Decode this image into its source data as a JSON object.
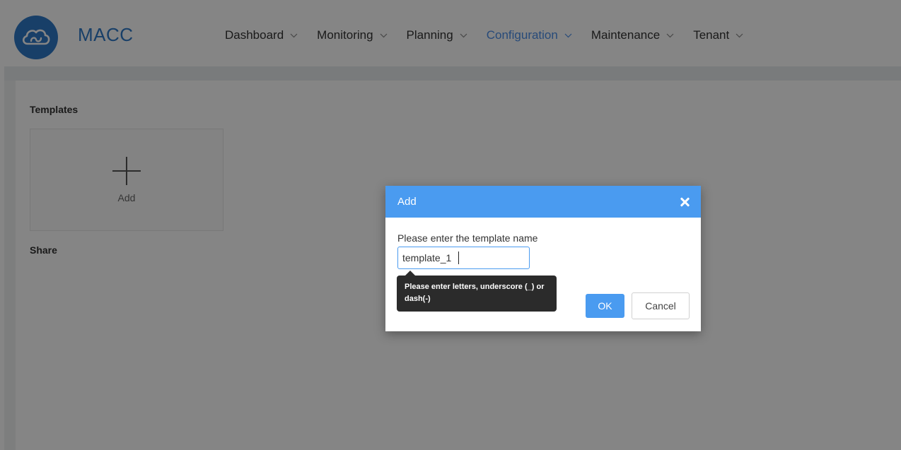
{
  "app": {
    "brand": "MACC",
    "logo_icon": "cloud-logo-icon"
  },
  "nav": {
    "items": [
      {
        "label": "Dashboard",
        "active": false
      },
      {
        "label": "Monitoring",
        "active": false
      },
      {
        "label": "Planning",
        "active": false
      },
      {
        "label": "Configuration",
        "active": true
      },
      {
        "label": "Maintenance",
        "active": false
      },
      {
        "label": "Tenant",
        "active": false
      }
    ]
  },
  "page": {
    "templates_title": "Templates",
    "add_card_label": "Add",
    "share_title": "Share"
  },
  "modal": {
    "title": "Add",
    "prompt": "Please enter the template name",
    "input_value": "template_1",
    "tooltip": "Please enter letters, underscore (_) or dash(-)",
    "ok_label": "OK",
    "cancel_label": "Cancel"
  },
  "colors": {
    "accent": "#4a9bf0",
    "brand": "#2f79c8",
    "tooltip_bg": "#2b2b2b"
  }
}
